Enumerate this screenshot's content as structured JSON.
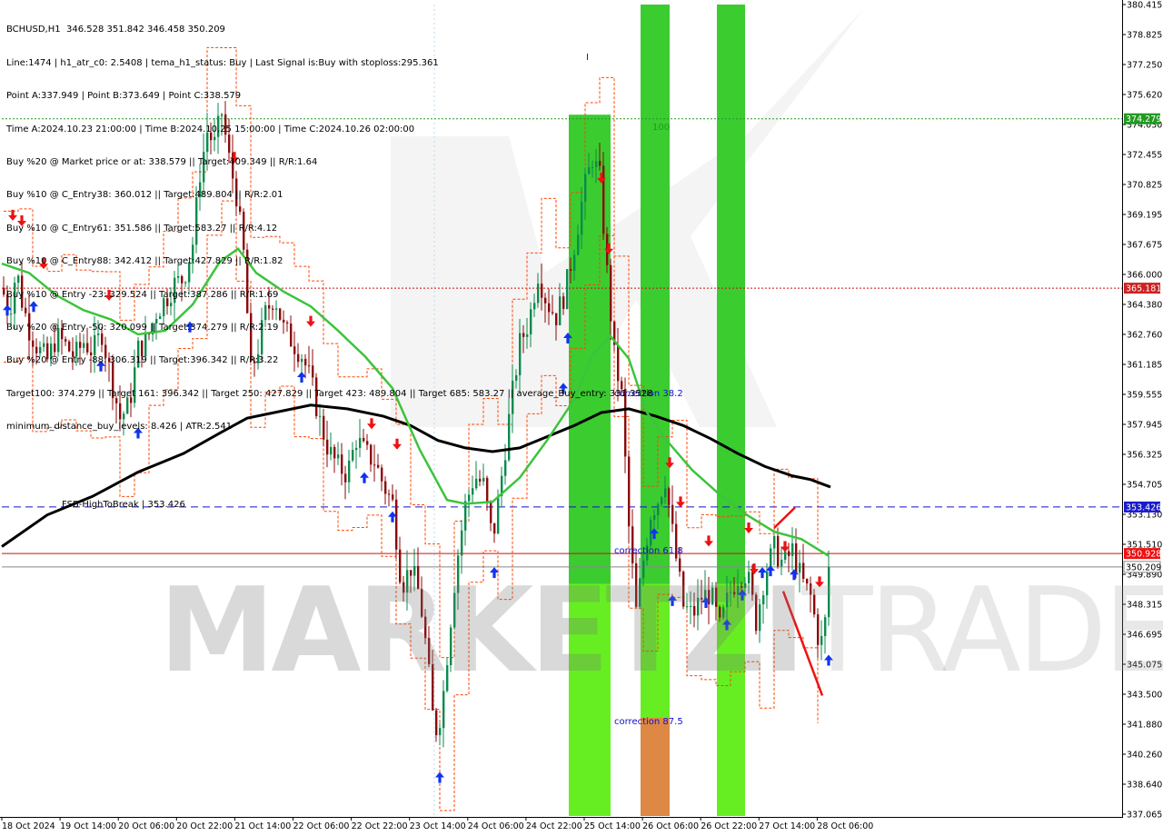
{
  "info_lines": [
    "BCHUSD,H1  346.528 351.842 346.458 350.209",
    "Line:1474 | h1_atr_c0: 2.5408 | tema_h1_status: Buy | Last Signal is:Buy with stoploss:295.361",
    "Point A:337.949 | Point B:373.649 | Point C:338.579",
    "Time A:2024.10.23 21:00:00 | Time B:2024.10.25 15:00:00 | Time C:2024.10.26 02:00:00",
    "Buy %20 @ Market price or at: 338.579 || Target:409.349 || R/R:1.64",
    "Buy %10 @ C_Entry38: 360.012 || Target:489.804 || R/R:2.01",
    "Buy %10 @ C_Entry61: 351.586 || Target:583.27 || R/R:4.12",
    "Buy %10 @ C_Entry88: 342.412 || Target:427.829 || R/R:1.82",
    "Buy %10 @ Entry -23: 329.524 || Target:387.286 || R/R:1.69",
    "Buy %20 @ Entry -50: 320.099 || Target:374.279 || R/R:2.19",
    "Buy %20 @ Entry -88: 306.319 || Target:396.342 || R/R:3.22",
    "Target100: 374.279 || Target 161: 396.342 || Target 250: 427.829 || Target 423: 489.804 || Target 685: 583.27 || average_Buy_entry: 331.3528",
    "minimum_distance_buy_levels: 8.426 | ATR:2.541"
  ],
  "watermark": {
    "bold": "MARKETZI",
    "light": "TRADE"
  },
  "annotations": {
    "fsb_label": "FSB-HighToBreak | 353.426",
    "corr_382": "correction 38.2",
    "corr_618": "correction 61.8",
    "corr_875": "correction 87.5",
    "level_100": "100",
    "marker_i": "I"
  },
  "colors": {
    "bull": "#0c8a4d",
    "bear": "#8b0a0a",
    "ema_slow": "#000000",
    "ema_fast": "#3cc43c",
    "band": "#ff4400",
    "zone_green": "#22cc22",
    "zone_lime": "#66ee22",
    "zone_orange": "#dd8844",
    "level_green": "#229922",
    "level_red": "#cc1111",
    "level_blue": "#1111cc",
    "level_current": "#888888",
    "arrow_buy": "#1133ee",
    "arrow_sell": "#ee1111"
  },
  "chart_data": {
    "type": "candlestick",
    "symbol": "BCHUSD",
    "timeframe": "H1",
    "ylim": [
      336.925,
      380.415
    ],
    "y_ticks": [
      "380.415",
      "378.825",
      "377.250",
      "375.620",
      "374.030",
      "372.455",
      "370.825",
      "369.195",
      "367.675",
      "366.000",
      "364.380",
      "362.760",
      "361.185",
      "359.555",
      "357.945",
      "356.325",
      "354.705",
      "353.130",
      "351.510",
      "349.890",
      "348.315",
      "346.695",
      "345.075",
      "343.500",
      "341.880",
      "340.260",
      "338.640",
      "337.065"
    ],
    "x_ticks": [
      "18 Oct 2024",
      "19 Oct 14:00",
      "20 Oct 06:00",
      "20 Oct 22:00",
      "21 Oct 14:00",
      "22 Oct 06:00",
      "22 Oct 22:00",
      "23 Oct 14:00",
      "24 Oct 06:00",
      "24 Oct 22:00",
      "25 Oct 14:00",
      "26 Oct 06:00",
      "26 Oct 22:00",
      "27 Oct 14:00",
      "28 Oct 06:00"
    ],
    "levels": [
      {
        "name": "target-100",
        "value": 374.279,
        "label": "374.279",
        "style": "green-dotted"
      },
      {
        "name": "level-365",
        "value": 365.181,
        "label": "365.181",
        "style": "red-dotted"
      },
      {
        "name": "fsb-high",
        "value": 353.426,
        "label": "353.426",
        "style": "blue-dashed"
      },
      {
        "name": "level-350",
        "value": 350.928,
        "label": "350.928",
        "style": "red-solid"
      },
      {
        "name": "current-price",
        "value": 350.209,
        "label": "350.209",
        "style": "gray-solid"
      }
    ],
    "close_path": [
      [
        0,
        365.2
      ],
      [
        8,
        363.8
      ],
      [
        16,
        366.2
      ],
      [
        22,
        364.5
      ],
      [
        30,
        363.0
      ],
      [
        40,
        361.9
      ],
      [
        50,
        361.3
      ],
      [
        60,
        362.6
      ],
      [
        70,
        362.1
      ],
      [
        80,
        361.5
      ],
      [
        90,
        362.3
      ],
      [
        100,
        361.8
      ],
      [
        110,
        362.8
      ],
      [
        120,
        360.4
      ],
      [
        130,
        358.2
      ],
      [
        140,
        358.9
      ],
      [
        150,
        361.9
      ],
      [
        160,
        362.4
      ],
      [
        170,
        363.9
      ],
      [
        180,
        364.6
      ],
      [
        190,
        365.4
      ],
      [
        200,
        365.7
      ],
      [
        210,
        367.6
      ],
      [
        218,
        371.4
      ],
      [
        226,
        373.6
      ],
      [
        234,
        372.9
      ],
      [
        242,
        374.6
      ],
      [
        250,
        372.1
      ],
      [
        258,
        370.2
      ],
      [
        266,
        367.0
      ],
      [
        274,
        360.6
      ],
      [
        282,
        362.0
      ],
      [
        290,
        363.8
      ],
      [
        300,
        364.8
      ],
      [
        310,
        363.0
      ],
      [
        320,
        362.3
      ],
      [
        330,
        361.6
      ],
      [
        340,
        360.2
      ],
      [
        350,
        358.0
      ],
      [
        360,
        356.4
      ],
      [
        370,
        355.6
      ],
      [
        380,
        355.2
      ],
      [
        390,
        357.1
      ],
      [
        400,
        356.3
      ],
      [
        410,
        355.9
      ],
      [
        420,
        354.6
      ],
      [
        430,
        353.6
      ],
      [
        440,
        349.2
      ],
      [
        450,
        350.2
      ],
      [
        460,
        348.6
      ],
      [
        468,
        345.4
      ],
      [
        476,
        341.2
      ],
      [
        484,
        342.5
      ],
      [
        492,
        346.5
      ],
      [
        500,
        350.3
      ],
      [
        510,
        353.5
      ],
      [
        520,
        355.1
      ],
      [
        530,
        354.6
      ],
      [
        540,
        351.6
      ],
      [
        550,
        355.1
      ],
      [
        560,
        358.9
      ],
      [
        570,
        362.2
      ],
      [
        580,
        363.4
      ],
      [
        590,
        366.0
      ],
      [
        600,
        364.4
      ],
      [
        610,
        363.7
      ],
      [
        620,
        365.0
      ],
      [
        630,
        367.5
      ],
      [
        640,
        370.3
      ],
      [
        650,
        372.2
      ],
      [
        658,
        371.1
      ],
      [
        666,
        366.0
      ],
      [
        674,
        361.5
      ],
      [
        682,
        359.4
      ],
      [
        690,
        352.3
      ],
      [
        698,
        347.8
      ],
      [
        706,
        350.6
      ],
      [
        714,
        353.1
      ],
      [
        722,
        353.8
      ],
      [
        730,
        355.0
      ],
      [
        740,
        351.3
      ],
      [
        750,
        348.1
      ],
      [
        760,
        347.6
      ],
      [
        770,
        348.6
      ],
      [
        780,
        348.8
      ],
      [
        790,
        346.9
      ],
      [
        800,
        348.7
      ],
      [
        810,
        349.7
      ],
      [
        820,
        349.9
      ],
      [
        830,
        347.3
      ],
      [
        840,
        349.9
      ],
      [
        850,
        351.2
      ],
      [
        860,
        350.3
      ],
      [
        870,
        351.1
      ],
      [
        880,
        349.5
      ],
      [
        890,
        348.6
      ],
      [
        900,
        346.0
      ],
      [
        905,
        346.5
      ],
      [
        910,
        350.2
      ]
    ],
    "ema_fast": [
      [
        0,
        366.5
      ],
      [
        30,
        366.0
      ],
      [
        60,
        364.8
      ],
      [
        90,
        364.0
      ],
      [
        120,
        363.5
      ],
      [
        150,
        362.7
      ],
      [
        180,
        362.9
      ],
      [
        210,
        364.3
      ],
      [
        240,
        366.6
      ],
      [
        260,
        367.3
      ],
      [
        280,
        366.0
      ],
      [
        310,
        365.0
      ],
      [
        340,
        364.2
      ],
      [
        370,
        362.9
      ],
      [
        400,
        361.5
      ],
      [
        430,
        359.8
      ],
      [
        460,
        356.5
      ],
      [
        490,
        353.8
      ],
      [
        510,
        353.6
      ],
      [
        540,
        353.7
      ],
      [
        570,
        355.0
      ],
      [
        600,
        357.0
      ],
      [
        630,
        359.2
      ],
      [
        650,
        361.6
      ],
      [
        670,
        362.6
      ],
      [
        690,
        361.4
      ],
      [
        710,
        358.5
      ],
      [
        730,
        357.1
      ],
      [
        760,
        355.4
      ],
      [
        790,
        354.1
      ],
      [
        820,
        353.0
      ],
      [
        850,
        352.1
      ],
      [
        880,
        351.7
      ],
      [
        910,
        350.8
      ]
    ],
    "ema_slow": [
      [
        0,
        351.3
      ],
      [
        50,
        353.0
      ],
      [
        100,
        354.0
      ],
      [
        150,
        355.3
      ],
      [
        200,
        356.3
      ],
      [
        240,
        357.4
      ],
      [
        270,
        358.2
      ],
      [
        300,
        358.5
      ],
      [
        340,
        358.9
      ],
      [
        380,
        358.7
      ],
      [
        420,
        358.3
      ],
      [
        450,
        357.8
      ],
      [
        480,
        357.0
      ],
      [
        510,
        356.6
      ],
      [
        540,
        356.4
      ],
      [
        570,
        356.6
      ],
      [
        600,
        357.2
      ],
      [
        630,
        357.8
      ],
      [
        660,
        358.5
      ],
      [
        690,
        358.7
      ],
      [
        720,
        358.3
      ],
      [
        750,
        357.8
      ],
      [
        780,
        357.1
      ],
      [
        810,
        356.3
      ],
      [
        840,
        355.6
      ],
      [
        870,
        355.1
      ],
      [
        890,
        354.9
      ],
      [
        912,
        354.5
      ]
    ],
    "zones": [
      {
        "name": "zone-1",
        "x0": 624,
        "x1": 670,
        "top": 374.5,
        "bottom": 336.925,
        "color": "green"
      },
      {
        "name": "zone-2",
        "x0": 703,
        "x1": 735,
        "top": 380.415,
        "bottom": 336.925,
        "color": "green-orange"
      },
      {
        "name": "zone-3",
        "x0": 787,
        "x1": 818,
        "top": 380.415,
        "bottom": 336.925,
        "color": "green"
      }
    ],
    "buy_arrows": [
      [
        6,
        364.0
      ],
      [
        35,
        364.2
      ],
      [
        109,
        361.0
      ],
      [
        150,
        357.4
      ],
      [
        207,
        363.1
      ],
      [
        330,
        360.4
      ],
      [
        399,
        355.0
      ],
      [
        430,
        352.9
      ],
      [
        482,
        338.9
      ],
      [
        542,
        349.9
      ],
      [
        618,
        359.8
      ],
      [
        623,
        362.5
      ],
      [
        718,
        352.0
      ],
      [
        738,
        348.4
      ],
      [
        775,
        348.3
      ],
      [
        798,
        347.1
      ],
      [
        815,
        348.7
      ],
      [
        837,
        349.9
      ],
      [
        846,
        350.0
      ],
      [
        872,
        349.8
      ],
      [
        910,
        345.2
      ]
    ],
    "sell_arrows": [
      [
        12,
        369.1
      ],
      [
        22,
        368.8
      ],
      [
        46,
        366.5
      ],
      [
        118,
        364.8
      ],
      [
        256,
        372.2
      ],
      [
        340,
        363.4
      ],
      [
        407,
        357.9
      ],
      [
        435,
        356.8
      ],
      [
        660,
        371.1
      ],
      [
        668,
        367.3
      ],
      [
        735,
        355.8
      ],
      [
        747,
        353.7
      ],
      [
        778,
        351.6
      ],
      [
        822,
        352.3
      ],
      [
        828,
        350.1
      ],
      [
        862,
        351.3
      ],
      [
        900,
        349.4
      ]
    ]
  }
}
